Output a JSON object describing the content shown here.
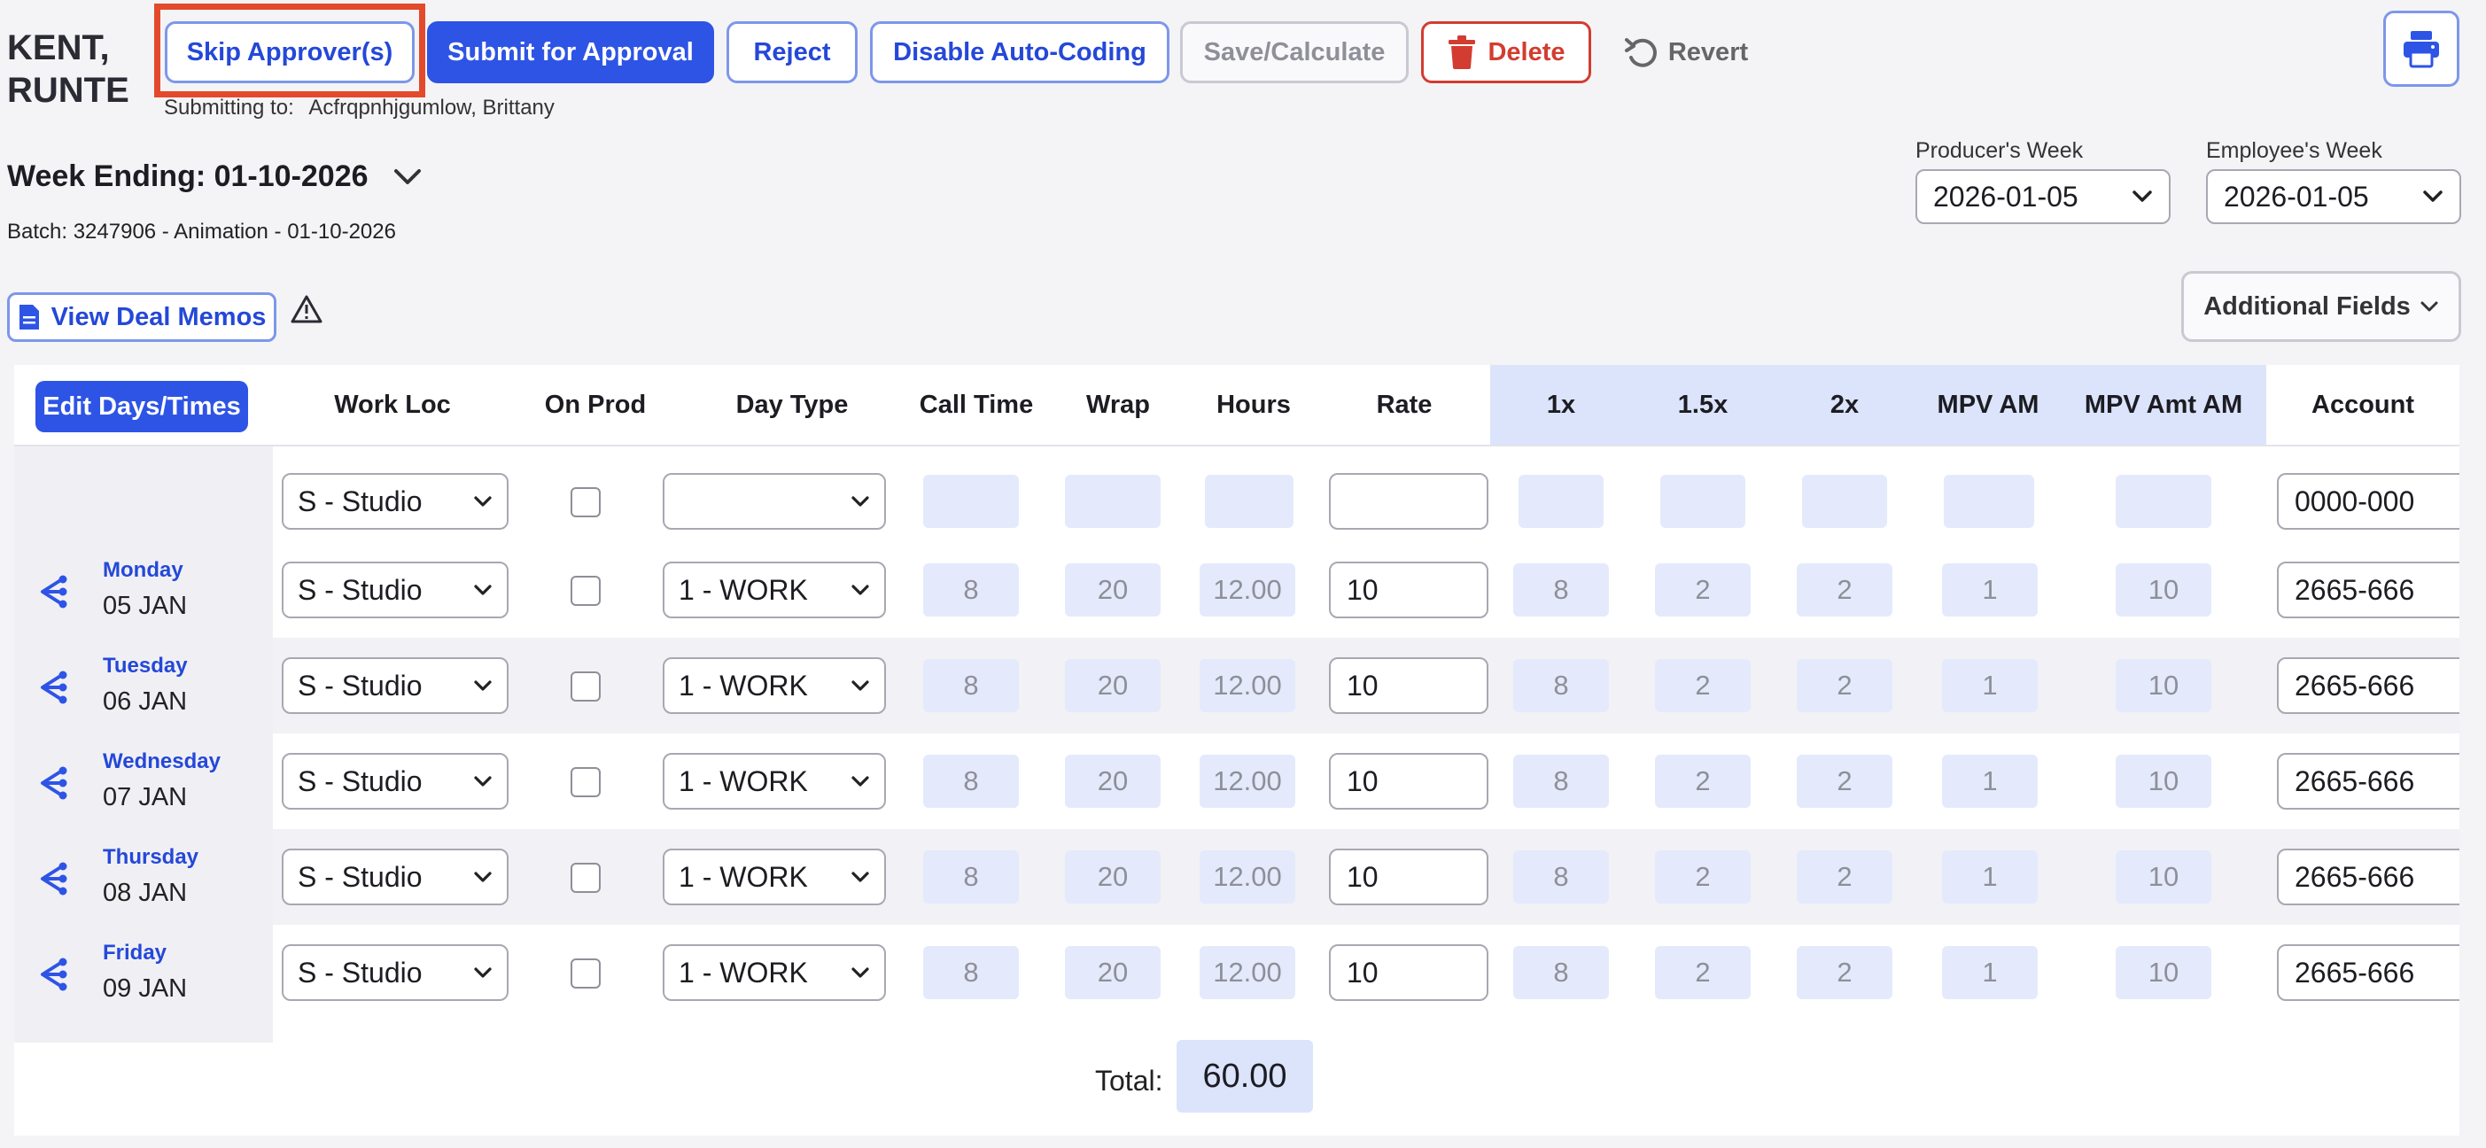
{
  "header": {
    "employee_name": "KENT, RUNTE",
    "buttons": {
      "skip_approvers": "Skip Approver(s)",
      "submit": "Submit for Approval",
      "reject": "Reject",
      "disable_auto_coding": "Disable Auto-Coding",
      "save_calculate": "Save/Calculate",
      "delete": "Delete",
      "revert": "Revert"
    },
    "submitting_to_label": "Submitting to:",
    "submitting_to_name": "Acfrqpnhjgumlow, Brittany"
  },
  "week": {
    "week_ending": "Week Ending: 01-10-2026",
    "batch": "Batch: 3247906 - Animation - 01-10-2026",
    "producers_week_label": "Producer's Week",
    "producers_week_value": "2026-01-05",
    "employees_week_label": "Employee's Week",
    "employees_week_value": "2026-01-05"
  },
  "actions": {
    "view_deal_memos": "View Deal Memos",
    "additional_fields": "Additional Fields"
  },
  "table": {
    "edit_days_label": "Edit Days/Times",
    "columns": {
      "work_loc": "Work Loc",
      "on_prod": "On Prod",
      "day_type": "Day Type",
      "call_time": "Call Time",
      "wrap": "Wrap",
      "hours": "Hours",
      "rate": "Rate",
      "x1": "1x",
      "x15": "1.5x",
      "x2": "2x",
      "mpv_am": "MPV AM",
      "mpv_amt_am": "MPV Amt AM",
      "account": "Account"
    },
    "template_row": {
      "work_loc": "S - Studio",
      "day_type": "",
      "rate": "",
      "account": "0000-000"
    },
    "rows": [
      {
        "day": "Monday",
        "date": "05 JAN",
        "work_loc": "S - Studio",
        "day_type": "1 - WORK",
        "call_time": "8",
        "wrap": "20",
        "hours": "12.00",
        "rate": "10",
        "x1": "8",
        "x15": "2",
        "x2": "2",
        "mpv_am": "1",
        "mpv_amt_am": "10",
        "account": "2665-666"
      },
      {
        "day": "Tuesday",
        "date": "06 JAN",
        "work_loc": "S - Studio",
        "day_type": "1 - WORK",
        "call_time": "8",
        "wrap": "20",
        "hours": "12.00",
        "rate": "10",
        "x1": "8",
        "x15": "2",
        "x2": "2",
        "mpv_am": "1",
        "mpv_amt_am": "10",
        "account": "2665-666"
      },
      {
        "day": "Wednesday",
        "date": "07 JAN",
        "work_loc": "S - Studio",
        "day_type": "1 - WORK",
        "call_time": "8",
        "wrap": "20",
        "hours": "12.00",
        "rate": "10",
        "x1": "8",
        "x15": "2",
        "x2": "2",
        "mpv_am": "1",
        "mpv_amt_am": "10",
        "account": "2665-666"
      },
      {
        "day": "Thursday",
        "date": "08 JAN",
        "work_loc": "S - Studio",
        "day_type": "1 - WORK",
        "call_time": "8",
        "wrap": "20",
        "hours": "12.00",
        "rate": "10",
        "x1": "8",
        "x15": "2",
        "x2": "2",
        "mpv_am": "1",
        "mpv_amt_am": "10",
        "account": "2665-666"
      },
      {
        "day": "Friday",
        "date": "09 JAN",
        "work_loc": "S - Studio",
        "day_type": "1 - WORK",
        "call_time": "8",
        "wrap": "20",
        "hours": "12.00",
        "rate": "10",
        "x1": "8",
        "x15": "2",
        "x2": "2",
        "mpv_am": "1",
        "mpv_amt_am": "10",
        "account": "2665-666"
      }
    ],
    "total_label": "Total:",
    "total_value": "60.00"
  },
  "colors": {
    "primary": "#2e54e6",
    "danger": "#d33c30",
    "highlight": "#e34a2b",
    "readonly_bg": "#e4eafc"
  }
}
